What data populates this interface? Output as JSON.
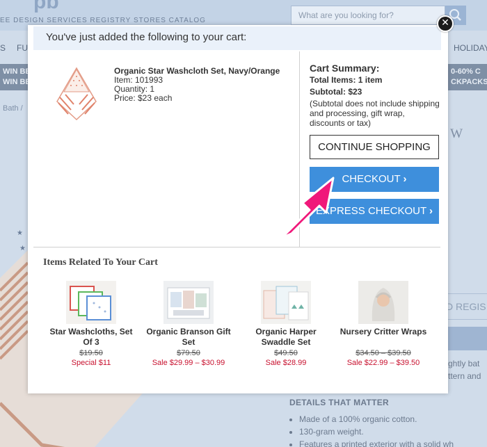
{
  "background": {
    "search_placeholder": "What are you looking for?",
    "nav_top": "EE DESIGN SERVICES   REGISTRY   STORES   CATALOG",
    "nav_items": [
      "S",
      "FU",
      "HOLIDAY"
    ],
    "banner_left": "WIN BE\nWIN BED",
    "banner_right": "0-60% C\nCKPACKS +",
    "breadcrumb": "Bath  /",
    "page_title": "th W",
    "registry_button": "D REGIS",
    "description": "ghtly bat\nttern and",
    "details_heading": "DETAILS THAT MATTER",
    "details": [
      "Made of a 100% organic cotton.",
      "130-gram weight.",
      "Features a printed exterior with a solid wh"
    ]
  },
  "modal": {
    "header": "You've just added the following to your cart:",
    "close_label": "✕",
    "product": {
      "name": "Organic Star Washcloth Set, Navy/Orange",
      "item": "Item:  101993",
      "quantity": "Quantity:  1",
      "price": "Price:  $23 each"
    },
    "summary": {
      "title": "Cart Summary:",
      "total_items": "Total Items:  1 item",
      "subtotal": "Subtotal:  $23",
      "note": "(Subtotal does not include shipping and processing, gift wrap, discounts or tax)"
    },
    "buttons": {
      "continue": "CONTINUE SHOPPING",
      "checkout": "CHECKOUT",
      "express": "EXPRESS CHECKOUT",
      "chevron": "›"
    },
    "related": {
      "title": "Items Related To Your Cart",
      "items": [
        {
          "name": "Star Washcloths, Set Of 3",
          "orig": "$19.50",
          "sale": "Special $11"
        },
        {
          "name": "Organic Branson Gift Set",
          "orig": "$79.50",
          "sale": "Sale $29.99 – $30.99"
        },
        {
          "name": "Organic Harper Swaddle Set",
          "orig": "$49.50",
          "sale": "Sale $28.99"
        },
        {
          "name": "Nursery Critter Wraps",
          "orig": "$34.50 – $39.50",
          "sale": "Sale $22.99 – $39.50"
        }
      ]
    }
  },
  "colors": {
    "checkout_blue": "#3e8fdc",
    "sale_red": "#c8102e",
    "arrow_pink": "#f0187a",
    "header_bg": "#eaf1fa"
  }
}
